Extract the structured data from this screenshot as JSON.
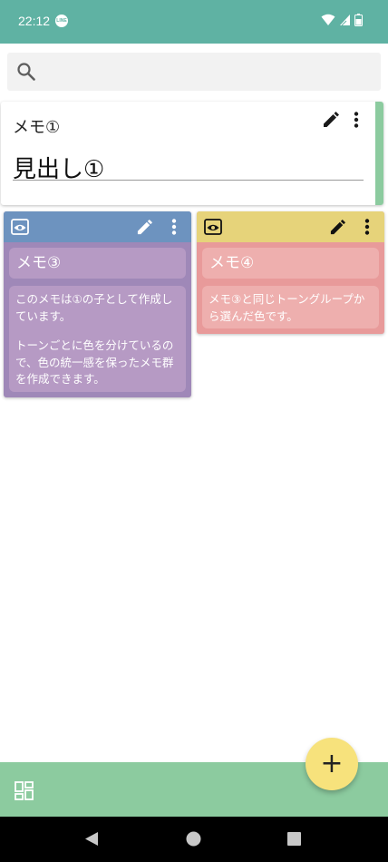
{
  "status_bar": {
    "time": "22:12",
    "app_badge": "LINE",
    "icons": [
      "line-icon",
      "wifi-icon",
      "signal-icon",
      "battery-icon"
    ]
  },
  "search": {
    "placeholder": ""
  },
  "memo1": {
    "title": "メモ①",
    "heading": "見出し①",
    "accent_color": "#8ccb9f"
  },
  "cards": [
    {
      "cap_color": "#6d93bf",
      "body_color": "#9f88b8",
      "inner_color": "#b69ac4",
      "title": "メモ③",
      "paragraphs": [
        "このメモは①の子として作成しています。",
        "トーンごとに色を分けているので、色の統一感を保ったメモ群を作成できます。"
      ]
    },
    {
      "cap_color": "#e6d37a",
      "body_color": "#e89a9a",
      "inner_color": "#eeafae",
      "title": "メモ④",
      "paragraphs": [
        "メモ③と同じトーングループから選んだ色です。"
      ]
    }
  ],
  "toolbar": {
    "bottom_color": "#8ccb9f",
    "fab_color": "#f7e27c",
    "fab_label": "+"
  },
  "icons": {
    "search": "search-icon",
    "edit": "pencil-icon",
    "more": "more-vert-icon",
    "view": "eye-icon",
    "layout": "dashboard-icon"
  }
}
